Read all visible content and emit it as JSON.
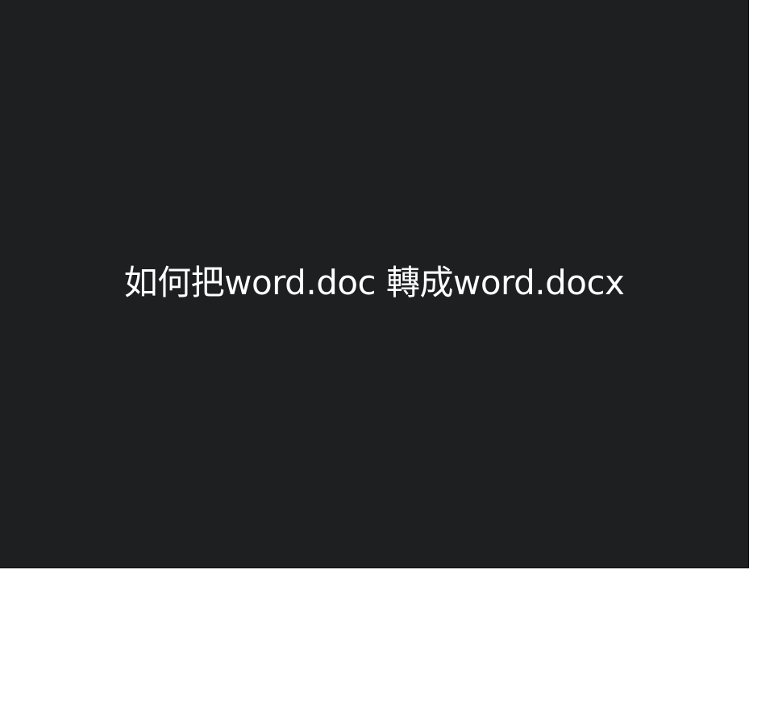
{
  "video": {
    "title": "如何把word.doc 轉成word.docx"
  },
  "colors": {
    "player_background": "#1e1f21",
    "title_text": "#ffffff",
    "page_background": "#ffffff"
  }
}
